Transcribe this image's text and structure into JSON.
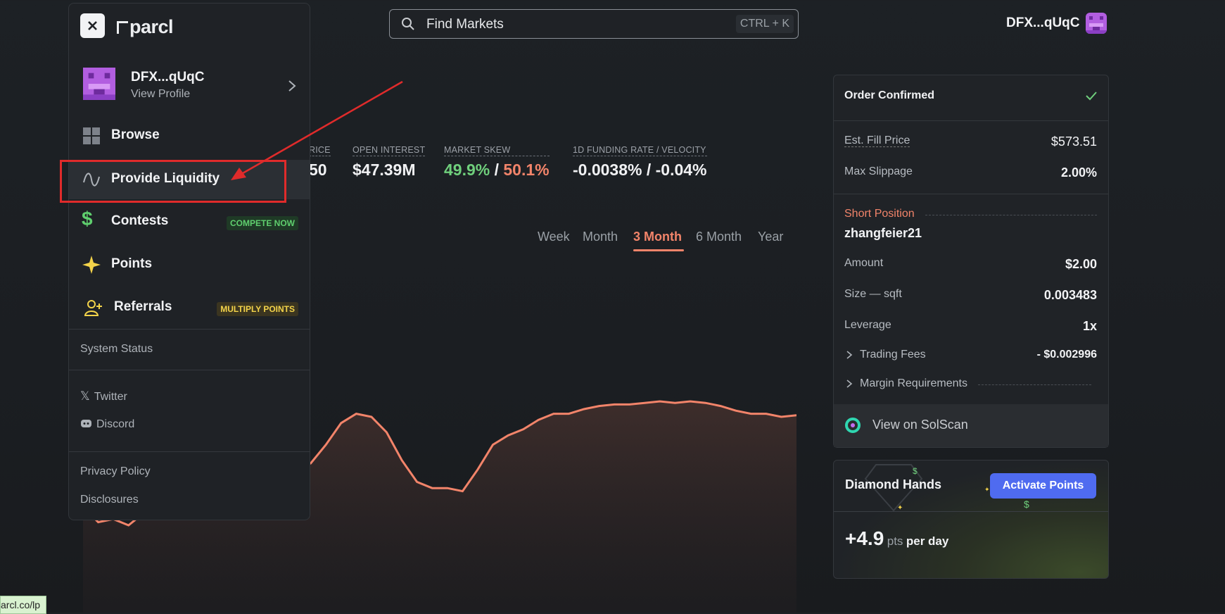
{
  "header": {
    "search_placeholder": "Find Markets",
    "search_shortcut": "CTRL + K",
    "user_short": "DFX...qUqC"
  },
  "stats": [
    {
      "label": "RICE",
      "value": "50"
    },
    {
      "label": "OPEN INTEREST",
      "value": "$47.39M"
    },
    {
      "label": "MARKET SKEW",
      "long": "49.9%",
      "sep": "/",
      "short": "50.1%"
    },
    {
      "label": "1D FUNDING RATE / VELOCITY",
      "value": "-0.0038% / -0.04%"
    }
  ],
  "time_tabs": [
    "Week",
    "Month",
    "3 Month",
    "6 Month",
    "Year"
  ],
  "active_tab": "3 Month",
  "chart_data": {
    "type": "area",
    "series_color": "#f2846a",
    "values": [
      0.32,
      0.22,
      0.24,
      0.2,
      0.28,
      0.3,
      0.32,
      0.36,
      0.44,
      0.5,
      0.52,
      0.53,
      0.5,
      0.55,
      0.56,
      0.6,
      0.72,
      0.86,
      0.92,
      0.9,
      0.8,
      0.62,
      0.48,
      0.44,
      0.44,
      0.42,
      0.56,
      0.72,
      0.78,
      0.82,
      0.88,
      0.92,
      0.92,
      0.95,
      0.97,
      0.98,
      0.98,
      0.99,
      1.0,
      0.99,
      1.0,
      0.99,
      0.97,
      0.94,
      0.92,
      0.92,
      0.9,
      0.91
    ]
  },
  "menu": {
    "logo": "parcl",
    "profile_name": "DFX...qUqC",
    "profile_sub": "View Profile",
    "items": [
      {
        "label": "Browse"
      },
      {
        "label": "Provide Liquidity"
      },
      {
        "label": "Contests",
        "badge": "COMPETE NOW"
      },
      {
        "label": "Points"
      },
      {
        "label": "Referrals",
        "badge": "MULTIPLY POINTS"
      }
    ],
    "system_status": "System Status",
    "twitter": "Twitter",
    "discord": "Discord",
    "privacy": "Privacy Policy",
    "disclosures": "Disclosures"
  },
  "order": {
    "title": "Order Confirmed",
    "fill_label": "Est. Fill Price",
    "fill_value": "$573.51",
    "slip_label": "Max Slippage",
    "slip_value": "2.00%",
    "position_label": "Short Position",
    "username": "zhangfeier21",
    "amount_label": "Amount",
    "amount_value": "$2.00",
    "size_label": "Size — sqft",
    "size_value": "0.003483",
    "lev_label": "Leverage",
    "lev_value": "1x",
    "fees_label": "Trading Fees",
    "fees_value": "- $0.002996",
    "margin_label": "Margin Requirements",
    "solscan": "View on SolScan"
  },
  "points": {
    "title": "Diamond Hands",
    "button": "Activate Points",
    "value": "+4.9",
    "unit": "pts",
    "per": "per day"
  },
  "status_url": "arcl.co/lp"
}
